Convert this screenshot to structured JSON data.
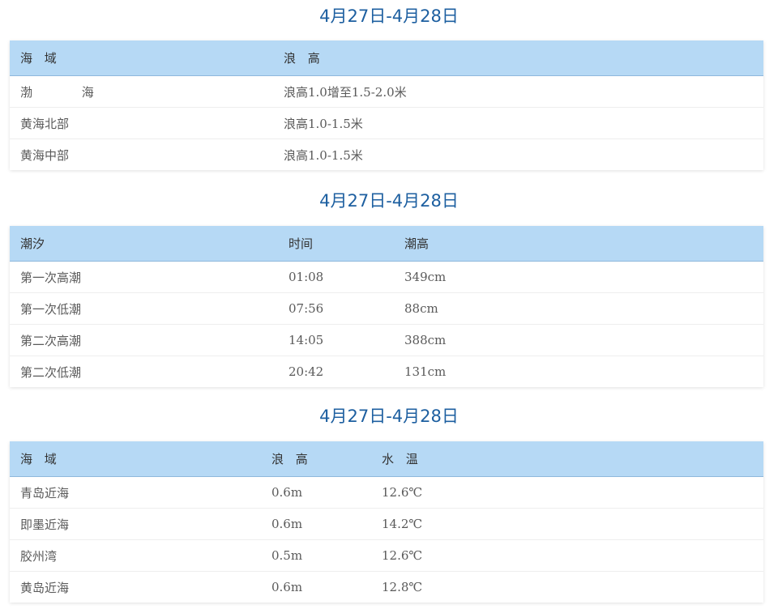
{
  "section1": {
    "title": "4月27日-4月28日",
    "headers": [
      "海 域",
      "浪 高"
    ],
    "rows": [
      [
        "渤 海",
        "浪高1.0增至1.5-2.0米"
      ],
      [
        "黄海北部",
        "浪高1.0-1.5米"
      ],
      [
        "黄海中部",
        "浪高1.0-1.5米"
      ]
    ]
  },
  "section2": {
    "title": "4月27日-4月28日",
    "headers": [
      "潮汐",
      "时间",
      "潮高"
    ],
    "rows": [
      [
        "第一次高潮",
        "01:08",
        "349cm"
      ],
      [
        "第一次低潮",
        "07:56",
        "88cm"
      ],
      [
        "第二次高潮",
        "14:05",
        "388cm"
      ],
      [
        "第二次低潮",
        "20:42",
        "131cm"
      ]
    ]
  },
  "section3": {
    "title": "4月27日-4月28日",
    "headers": [
      "海 域",
      "浪 高",
      "水 温"
    ],
    "rows": [
      [
        "青岛近海",
        "0.6m",
        "12.6℃"
      ],
      [
        "即墨近海",
        "0.6m",
        "14.2℃"
      ],
      [
        "胶州湾",
        "0.5m",
        "12.6℃"
      ],
      [
        "黄岛近海",
        "0.6m",
        "12.8℃"
      ]
    ]
  },
  "colors": {
    "title": "#1d5fa0",
    "header_bg": "#b6d9f5",
    "text": "#5a5a5a"
  }
}
